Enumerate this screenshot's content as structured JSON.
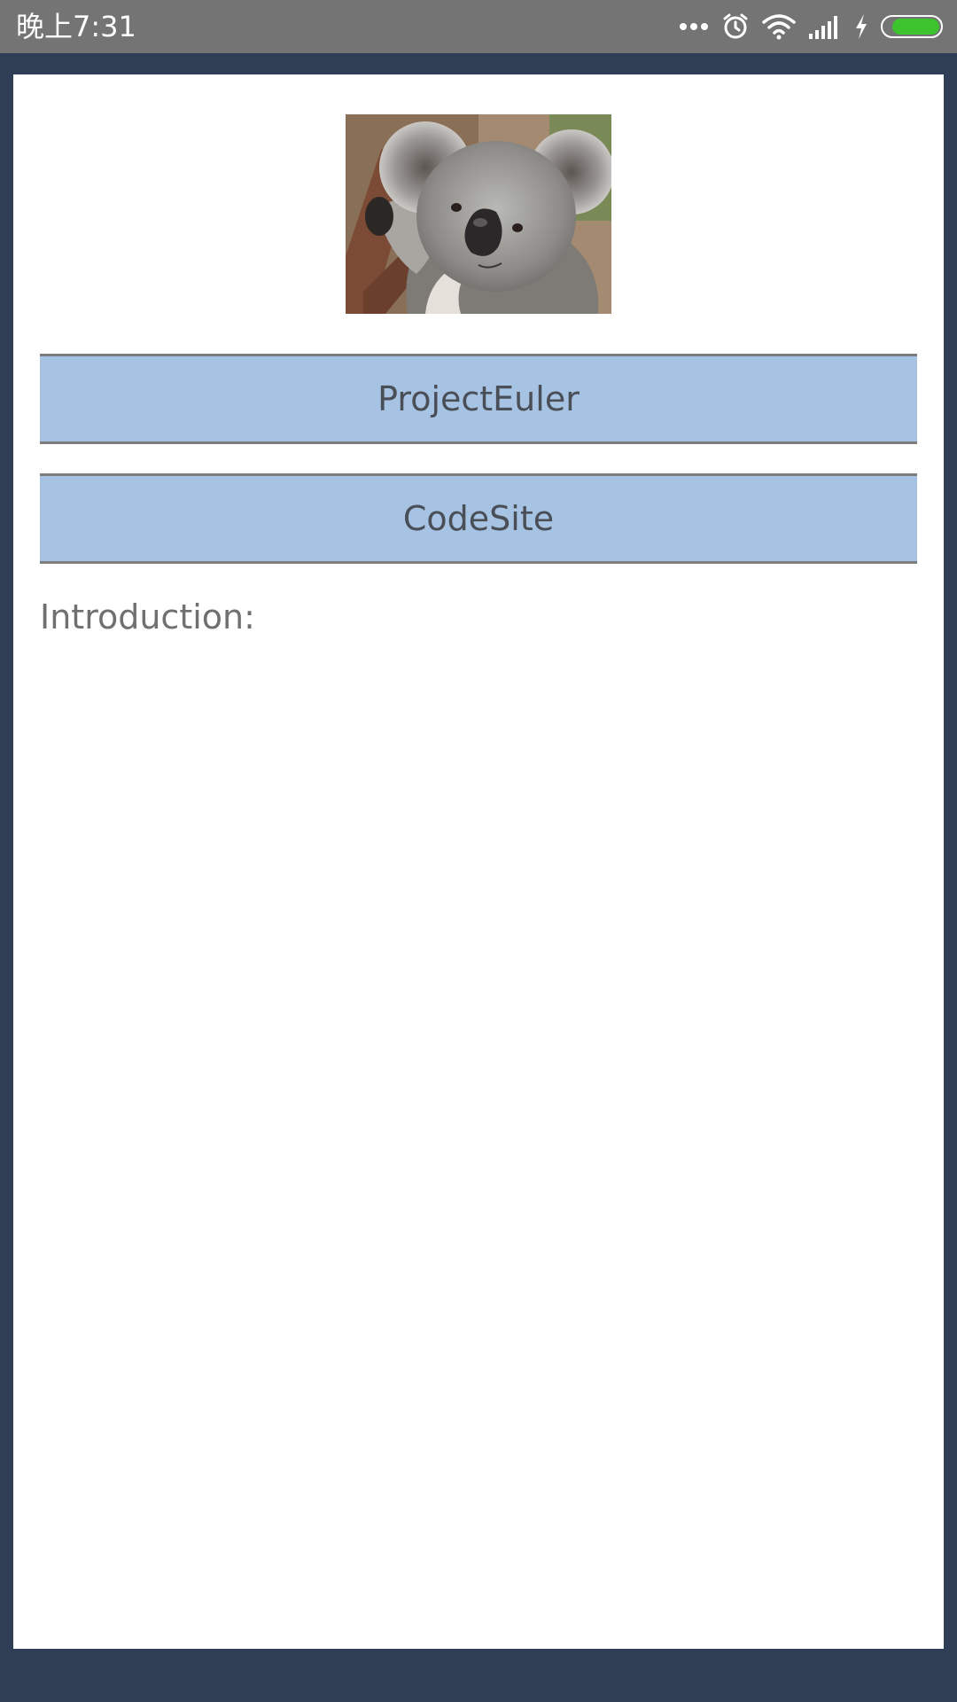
{
  "status_bar": {
    "time": "晚上7:31",
    "icons": [
      "more-dots-icon",
      "alarm-icon",
      "wifi-icon",
      "signal-icon",
      "charging-icon",
      "battery-icon"
    ],
    "battery_level": 0.85,
    "battery_color": "#3cc32d"
  },
  "header_image": {
    "subject": "koala"
  },
  "buttons": {
    "project_euler": "ProjectEuler",
    "code_site": "CodeSite"
  },
  "introduction": {
    "label": "Introduction:"
  },
  "colors": {
    "background": "#2f3d55",
    "status_bar": "#747474",
    "card": "#ffffff",
    "button_fill": "#a6c3e3",
    "button_border": "#7d7d80"
  }
}
